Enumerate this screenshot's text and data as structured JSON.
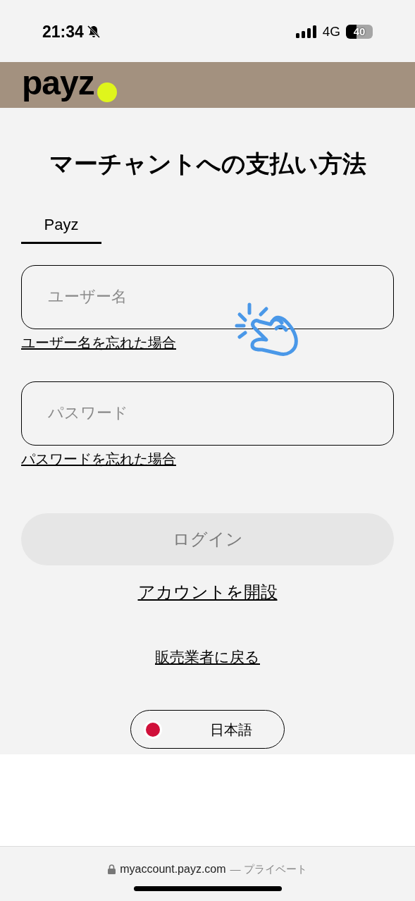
{
  "status_bar": {
    "time": "21:34",
    "network": "4G",
    "battery": "40"
  },
  "header": {
    "logo": "payz"
  },
  "title": "マーチャントへの支払い方法",
  "tabs": [
    {
      "label": "Payz",
      "selected": true
    }
  ],
  "fields": [
    {
      "placeholder": "ユーザー名",
      "link": "ユーザー名を忘れた場合"
    },
    {
      "placeholder": "パスワード",
      "link": "パスワードを忘れた場合"
    }
  ],
  "login_button": {
    "label": "ログイン",
    "disabled": true
  },
  "open_account_link": "アカウントを開設",
  "back_link": "販売業者に戻る",
  "language": {
    "label": "日本語"
  },
  "browser_bar": {
    "url": "myaccount.payz.com",
    "suffix": "— プライベート"
  }
}
